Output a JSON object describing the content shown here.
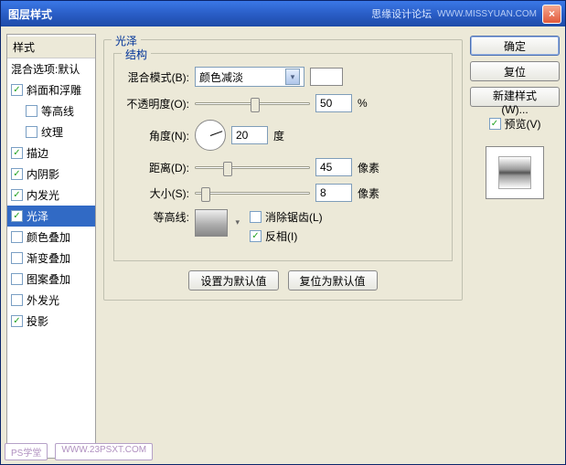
{
  "window": {
    "title": "图层样式",
    "brand": "思缘设计论坛",
    "url": "WWW.MISSYUAN.COM",
    "close": "×"
  },
  "sidebar": {
    "header": "样式",
    "blend_default": "混合选项:默认",
    "items": [
      {
        "label": "斜面和浮雕",
        "checked": true,
        "indent": false
      },
      {
        "label": "等高线",
        "checked": false,
        "indent": true
      },
      {
        "label": "纹理",
        "checked": false,
        "indent": true
      },
      {
        "label": "描边",
        "checked": true,
        "indent": false
      },
      {
        "label": "内阴影",
        "checked": true,
        "indent": false
      },
      {
        "label": "内发光",
        "checked": true,
        "indent": false
      },
      {
        "label": "光泽",
        "checked": true,
        "indent": false,
        "selected": true
      },
      {
        "label": "颜色叠加",
        "checked": false,
        "indent": false
      },
      {
        "label": "渐变叠加",
        "checked": false,
        "indent": false
      },
      {
        "label": "图案叠加",
        "checked": false,
        "indent": false
      },
      {
        "label": "外发光",
        "checked": false,
        "indent": false
      },
      {
        "label": "投影",
        "checked": true,
        "indent": false
      }
    ]
  },
  "main": {
    "group_title": "光泽",
    "structure_title": "结构",
    "blend_mode_label": "混合模式(B):",
    "blend_mode_value": "颜色减淡",
    "opacity_label": "不透明度(O):",
    "opacity_value": "50",
    "opacity_unit": "%",
    "angle_label": "角度(N):",
    "angle_value": "20",
    "angle_unit": "度",
    "distance_label": "距离(D):",
    "distance_value": "45",
    "distance_unit": "像素",
    "size_label": "大小(S):",
    "size_value": "8",
    "size_unit": "像素",
    "contour_label": "等高线:",
    "antialias_label": "消除锯齿(L)",
    "invert_label": "反相(I)",
    "set_default": "设置为默认值",
    "reset_default": "复位为默认值"
  },
  "right": {
    "ok": "确定",
    "reset": "复位",
    "new_style": "新建样式(W)...",
    "preview": "预览(V)"
  },
  "footer": {
    "tag1": "PS学堂",
    "tag2": "WWW.23PSXT.COM"
  }
}
